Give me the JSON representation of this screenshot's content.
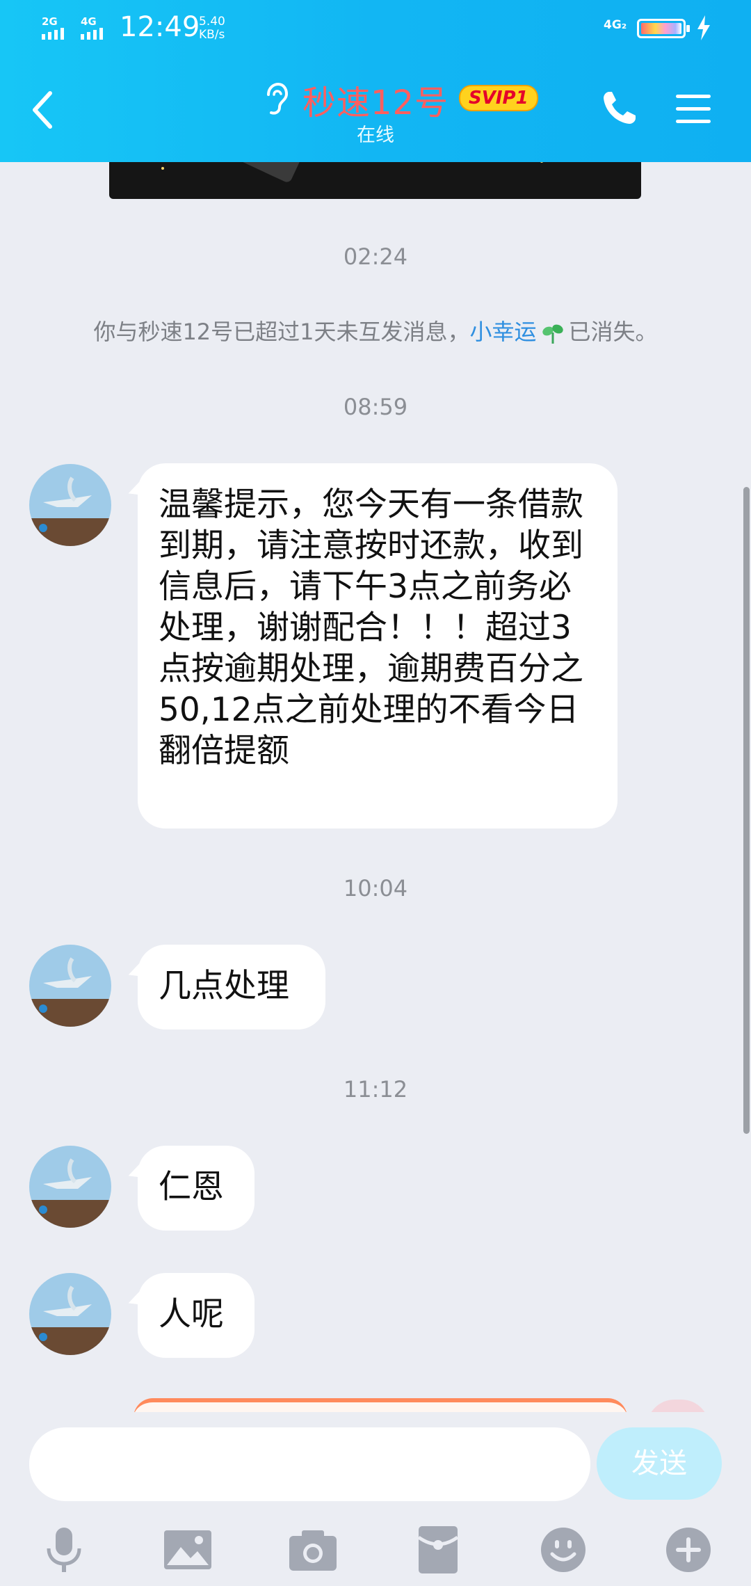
{
  "status_bar": {
    "sig1": "2G",
    "sig2": "4G",
    "time": "12:49",
    "speed_value": "5.40",
    "speed_unit": "KB/s",
    "network": "4G₂"
  },
  "header": {
    "title": "秒速12号",
    "badge": "SVIP1",
    "subtitle": "在线"
  },
  "timestamps": [
    "02:24",
    "08:59",
    "10:04",
    "11:12"
  ],
  "system_notice": {
    "prefix": "你与秒速12号已超过1天未互发消息，",
    "link": "小幸运",
    "suffix": "已消失。"
  },
  "messages": [
    {
      "text": "温馨提示，您今天有一条借款到期，请注意按时还款，收到信息后，请下午3点之前务必处理，谢谢配合！！！超过3点按逾期处理，逾期费百分之50,12点之前处理的不看今日翻倍提额"
    },
    {
      "text": "几点处理"
    },
    {
      "text": "仁恩"
    },
    {
      "text": "人呢"
    }
  ],
  "input": {
    "placeholder": "",
    "send_label": "发送"
  },
  "colors": {
    "header_bg": "#12b6f3",
    "title": "#ff5f5f",
    "link": "#2f8fe0",
    "badge_bg": "#ffd21e"
  },
  "toolbar_icons": [
    "microphone-icon",
    "image-icon",
    "camera-icon",
    "red-packet-icon",
    "emoji-icon",
    "plus-icon"
  ]
}
